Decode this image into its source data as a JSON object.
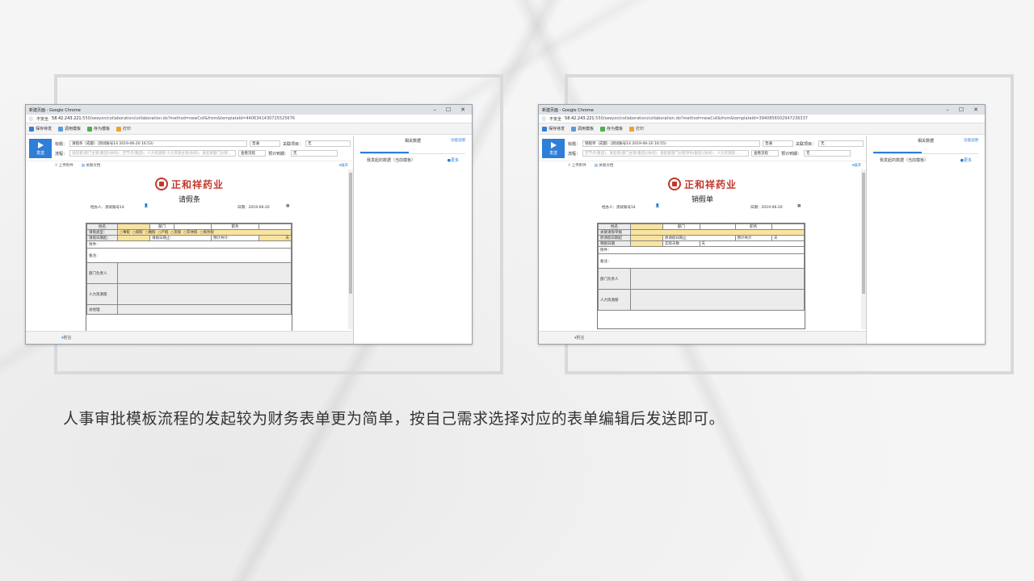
{
  "caption": "人事审批模板流程的发起较为财务表单更为简单，按自己需求选择对应的表单编辑后发送即可。",
  "company_logo_text": "正和祥药业",
  "colors": {
    "accent": "#2f7ed8",
    "highlight": "#f9e3a0",
    "logo": "#c0392b"
  },
  "screenshots": [
    {
      "window_title": "新建页面 - Google Chrome",
      "security": "不安全",
      "url_host": "58.42.243.221",
      "url_rest": ":550/seeyon/collaboration/collaboration.do?method=newColl&from&templateId=4406341430725525676",
      "window_controls": [
        "–",
        "☐",
        "✕"
      ],
      "toolbar": [
        "保存待发",
        "调用模板",
        "存为模板",
        "打印"
      ],
      "send_label": "发送",
      "subject_label": "标题：",
      "subject_value": "请假条（成都）(测试账号14 2019-06-20 16:53)",
      "priority": "普通",
      "related_project_label": "关联项目：",
      "related_project_value": "无",
      "flow_label": "流程：",
      "flow_placeholder": "发起者(部门主管(集团)(协同)、空节点(集团)、人力资源部-人力资源主管(协同)、发起者部门分管...",
      "view_flow": "查看流程",
      "deadline_label": "预计到期：",
      "deadline_value": "无",
      "upload_attach": "上传附件",
      "related_doc": "关联文档",
      "expand": "展开",
      "form_title": "请假条",
      "operator": "经办人：测试账号14",
      "date": "日期：2019-06-20",
      "form_rows": [
        "姓名",
        "部门",
        "职务",
        "请假类型：",
        "事假",
        "病假",
        "婚假",
        "产假",
        "丧假",
        "年休假",
        "探亲假",
        "请假日期起：",
        "请假日期止：",
        "预计共计：",
        "天",
        "附件：",
        "备注：",
        "部门负责人",
        "人力资源部",
        "总经理"
      ],
      "footer": "附言",
      "right_title": "相关数据",
      "right_help": "功能说明",
      "right_data": "我发起的数据（当前模板）",
      "right_more": "更多"
    },
    {
      "window_title": "新建页面 - Google Chrome",
      "security": "不安全",
      "url_host": "58.42.243.221",
      "url_rest": ":550/seeyon/collaboration/collaboration.do?method=newColl&from&templateId=3940856502947236337",
      "window_controls": [
        "–",
        "☐",
        "✕"
      ],
      "toolbar": [
        "保存待发",
        "调用模板",
        "存为模板",
        "打印"
      ],
      "send_label": "发送",
      "subject_label": "标题：",
      "subject_value": "销假单（成都）(测试账号14 2019-06-20 16:55)",
      "priority": "普通",
      "related_project_label": "关联项目：",
      "related_project_value": "无",
      "flow_label": "流程：",
      "flow_placeholder": "空节点(集团)、发起者(部门主管(集团)(协同)、发起者部门分管领导(集团)(协同)、人力资源部...",
      "view_flow": "查看流程",
      "deadline_label": "预计到期：",
      "deadline_value": "无",
      "upload_attach": "上传附件",
      "related_doc": "关联文档",
      "expand": "展开",
      "form_title": "销假单",
      "operator": "经办人：测试账号14",
      "date": "日期：2019-06-20",
      "form_rows": [
        "姓名",
        "部门",
        "职务",
        "关联请假单据",
        "原请假日期起",
        "原请假日期止",
        "预计共计",
        "天",
        "销假日期",
        "实际天数",
        "天",
        "附件：",
        "备注：",
        "部门负责人",
        "人力资源部"
      ],
      "footer": "附言",
      "right_title": "相关数据",
      "right_help": "功能说明",
      "right_data": "我发起的数据（当前模板）",
      "right_more": "更多"
    }
  ]
}
